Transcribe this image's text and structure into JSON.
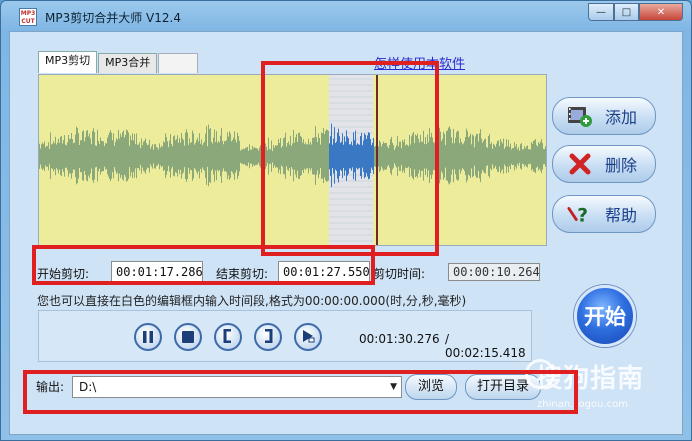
{
  "window": {
    "title": "MP3剪切合并大师 V12.4",
    "icon_text": "MP3 CUT",
    "controls": {
      "minimize": "—",
      "maximize": "□",
      "close": "✕"
    }
  },
  "tabs": [
    {
      "label": "MP3剪切",
      "active": true
    },
    {
      "label": "MP3合并",
      "active": false
    }
  ],
  "help_link": "怎样使用本软件",
  "side_buttons": {
    "add": {
      "label": "添加",
      "icon": "film-add-icon"
    },
    "delete": {
      "label": "删除",
      "icon": "red-x-icon"
    },
    "help": {
      "label": "帮助",
      "icon": "question-icon"
    }
  },
  "cut": {
    "start_label": "开始剪切:",
    "start_value": "00:01:17.286",
    "end_label": "结束剪切:",
    "end_value": "00:01:27.550",
    "duration_label": "剪切时间:",
    "duration_value": "00:00:10.264",
    "hint": "您也可以直接在白色的编辑框内输入时间段,格式为00:00:00.000(时,分,秒,毫秒)"
  },
  "player": {
    "buttons": [
      "pause-icon",
      "stop-icon",
      "mark-start-icon",
      "mark-end-icon",
      "play-selection-icon"
    ],
    "position": "00:01:30.276",
    "total": "/ 00:02:15.418"
  },
  "start_button": {
    "label": "开始"
  },
  "output": {
    "label": "输出:",
    "path": "D:\\",
    "browse_label": "浏览",
    "open_dir_label": "打开目录"
  },
  "watermark": {
    "text": "搜狗指南",
    "sub": "zhinan.sogou.com"
  },
  "colors": {
    "wave_bg": "#ecec9a",
    "wave_color": "#8aa87a",
    "selection_bg": "#e2e4ea",
    "selection_wave": "#3a78c4",
    "annotation": "#e02020",
    "link": "#2a2ad0"
  }
}
